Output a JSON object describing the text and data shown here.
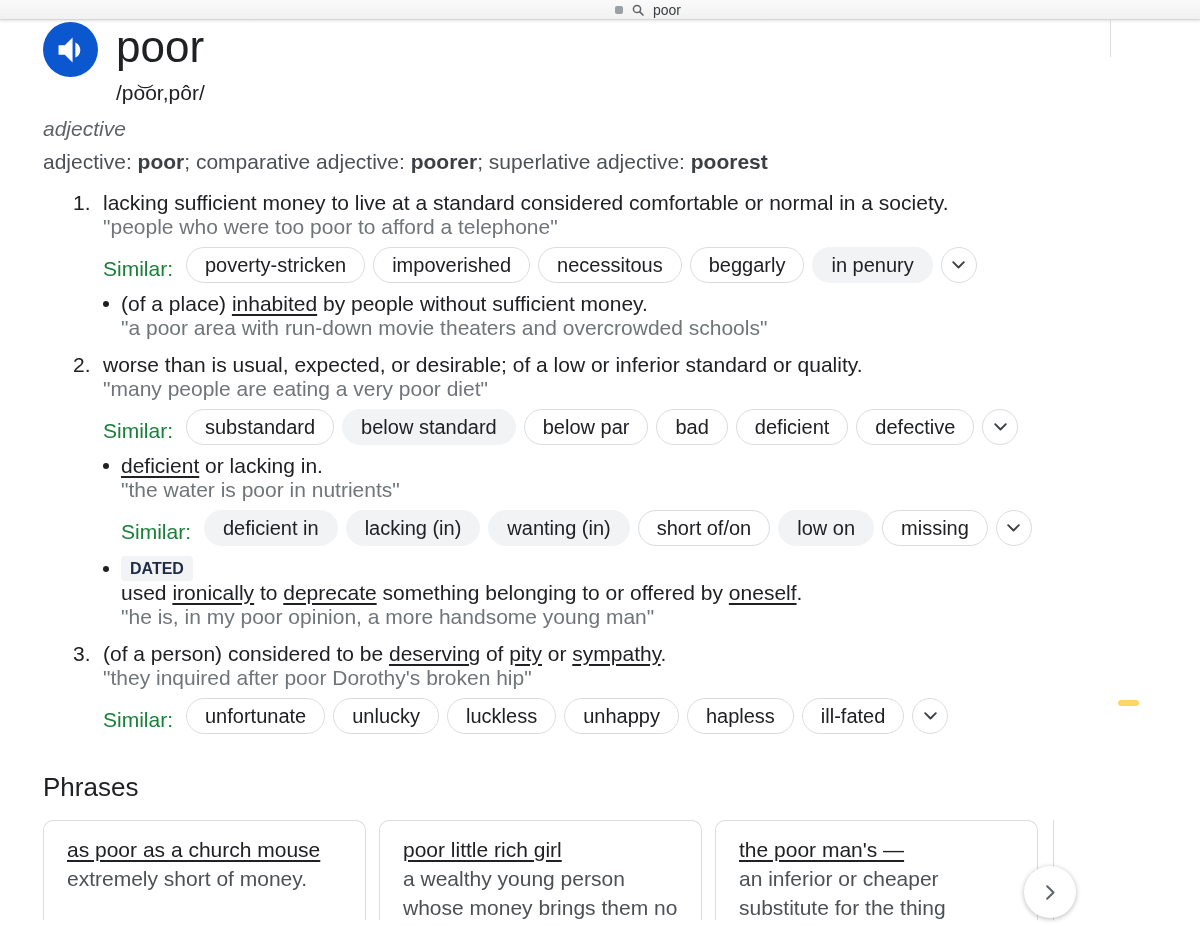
{
  "address_bar": {
    "text": "poor"
  },
  "entry": {
    "headword": "poor",
    "pronunciation": "/po͝or,pôr/",
    "part_of_speech": "adjective",
    "forms": "adjective: **poor**; comparative adjective: **poorer**; superlative adjective: **poorest**"
  },
  "senses": [
    {
      "number": "1.",
      "definition": [
        {
          "text": "lacking sufficient money to live at a standard considered comfortable or normal in a society.",
          "link": false
        }
      ],
      "example": "\"people who were too poor to afford a telephone\"",
      "similar": {
        "label": "Similar:",
        "chips": [
          {
            "label": "poverty-stricken",
            "highlighted": false
          },
          {
            "label": "impoverished",
            "highlighted": false
          },
          {
            "label": "necessitous",
            "highlighted": false
          },
          {
            "label": "beggarly",
            "highlighted": false
          },
          {
            "label": "in penury",
            "highlighted": true
          }
        ]
      },
      "subsenses": [
        {
          "definition": [
            {
              "text": "(of a place) ",
              "link": false
            },
            {
              "text": "inhabited",
              "link": true
            },
            {
              "text": " by people without sufficient money.",
              "link": false
            }
          ],
          "example": "\"a poor area with run-down movie theaters and overcrowded schools\""
        }
      ]
    },
    {
      "number": "2.",
      "definition": [
        {
          "text": "worse than is usual, expected, or desirable; of a low or inferior standard or quality.",
          "link": false
        }
      ],
      "example": "\"many people are eating a very poor diet\"",
      "similar": {
        "label": "Similar:",
        "chips": [
          {
            "label": "substandard",
            "highlighted": false
          },
          {
            "label": "below standard",
            "highlighted": true
          },
          {
            "label": "below par",
            "highlighted": false
          },
          {
            "label": "bad",
            "highlighted": false
          },
          {
            "label": "deficient",
            "highlighted": false
          },
          {
            "label": "defective",
            "highlighted": false
          }
        ]
      },
      "subsenses": [
        {
          "definition": [
            {
              "text": "deficient",
              "link": true
            },
            {
              "text": " or lacking in.",
              "link": false
            }
          ],
          "example": "\"the water is poor in nutrients\"",
          "similar": {
            "label": "Similar:",
            "chips": [
              {
                "label": "deficient in",
                "highlighted": true
              },
              {
                "label": "lacking (in)",
                "highlighted": true
              },
              {
                "label": "wanting (in)",
                "highlighted": true
              },
              {
                "label": "short of/on",
                "highlighted": false
              },
              {
                "label": "low on",
                "highlighted": true
              },
              {
                "label": "missing",
                "highlighted": false
              }
            ]
          }
        },
        {
          "label": "DATED",
          "definition": [
            {
              "text": "used ",
              "link": false
            },
            {
              "text": "ironically",
              "link": true
            },
            {
              "text": " to ",
              "link": false
            },
            {
              "text": "deprecate",
              "link": true
            },
            {
              "text": " something belonging to or offered by ",
              "link": false
            },
            {
              "text": "oneself",
              "link": true
            },
            {
              "text": ".",
              "link": false
            }
          ],
          "example": "\"he is, in my poor opinion, a more handsome young man\""
        }
      ]
    },
    {
      "number": "3.",
      "definition": [
        {
          "text": "(of a person) considered to be ",
          "link": false
        },
        {
          "text": "deserving",
          "link": true
        },
        {
          "text": " of ",
          "link": false
        },
        {
          "text": "pity",
          "link": true
        },
        {
          "text": " or ",
          "link": false
        },
        {
          "text": "sympathy",
          "link": true
        },
        {
          "text": ".",
          "link": false
        }
      ],
      "example": "\"they inquired after poor Dorothy's broken hip\"",
      "similar": {
        "label": "Similar:",
        "chips": [
          {
            "label": "unfortunate",
            "highlighted": false
          },
          {
            "label": "unlucky",
            "highlighted": false
          },
          {
            "label": "luckless",
            "highlighted": false
          },
          {
            "label": "unhappy",
            "highlighted": false
          },
          {
            "label": "hapless",
            "highlighted": false
          },
          {
            "label": "ill-fated",
            "highlighted": false
          }
        ]
      }
    }
  ],
  "phrases": {
    "title": "Phrases",
    "cards": [
      {
        "phrase": "as poor as a church mouse",
        "meaning": "extremely short of money."
      },
      {
        "phrase": "poor little rich girl",
        "meaning": "a wealthy young person whose money brings them no"
      },
      {
        "phrase": "the poor man's —",
        "meaning": "an inferior or cheaper substitute for the thing"
      }
    ]
  }
}
